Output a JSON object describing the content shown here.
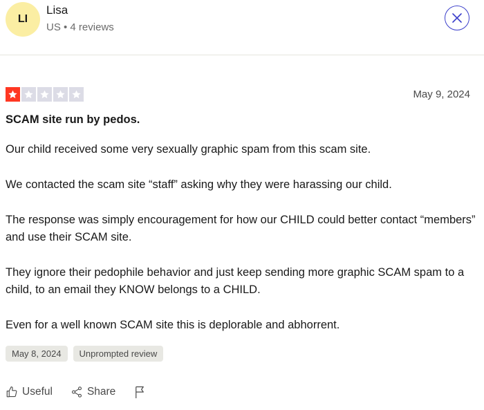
{
  "reviewer": {
    "initials": "LI",
    "name": "Lisa",
    "meta": "US • 4 reviews"
  },
  "review": {
    "rating": 1,
    "max_rating": 5,
    "date": "May 9, 2024",
    "title": "SCAM site run by pedos.",
    "paragraphs": [
      "Our child received some very sexually graphic spam from this scam site.",
      "We contacted the scam site “staff” asking why they were harassing our child.",
      "The response was simply encouragement for how our CHILD could better contact “members” and use their SCAM site.",
      "They ignore their pedophile behavior and just keep sending more graphic SCAM spam to a child, to an email they KNOW belongs to a CHILD.",
      "Even for a well known SCAM site this is deplorable and abhorrent."
    ],
    "tags": {
      "experience_date": "May 8, 2024",
      "review_type": "Unprompted review"
    }
  },
  "actions": {
    "useful_label": "Useful",
    "share_label": "Share",
    "useful_icon": "thumbs-up-icon",
    "share_icon": "share-icon",
    "report_icon": "flag-icon"
  },
  "colors": {
    "star_filled": "#ff3722",
    "star_empty": "#dcdce6",
    "avatar_bg": "#fbeea3",
    "accent": "#3b3fcb"
  }
}
